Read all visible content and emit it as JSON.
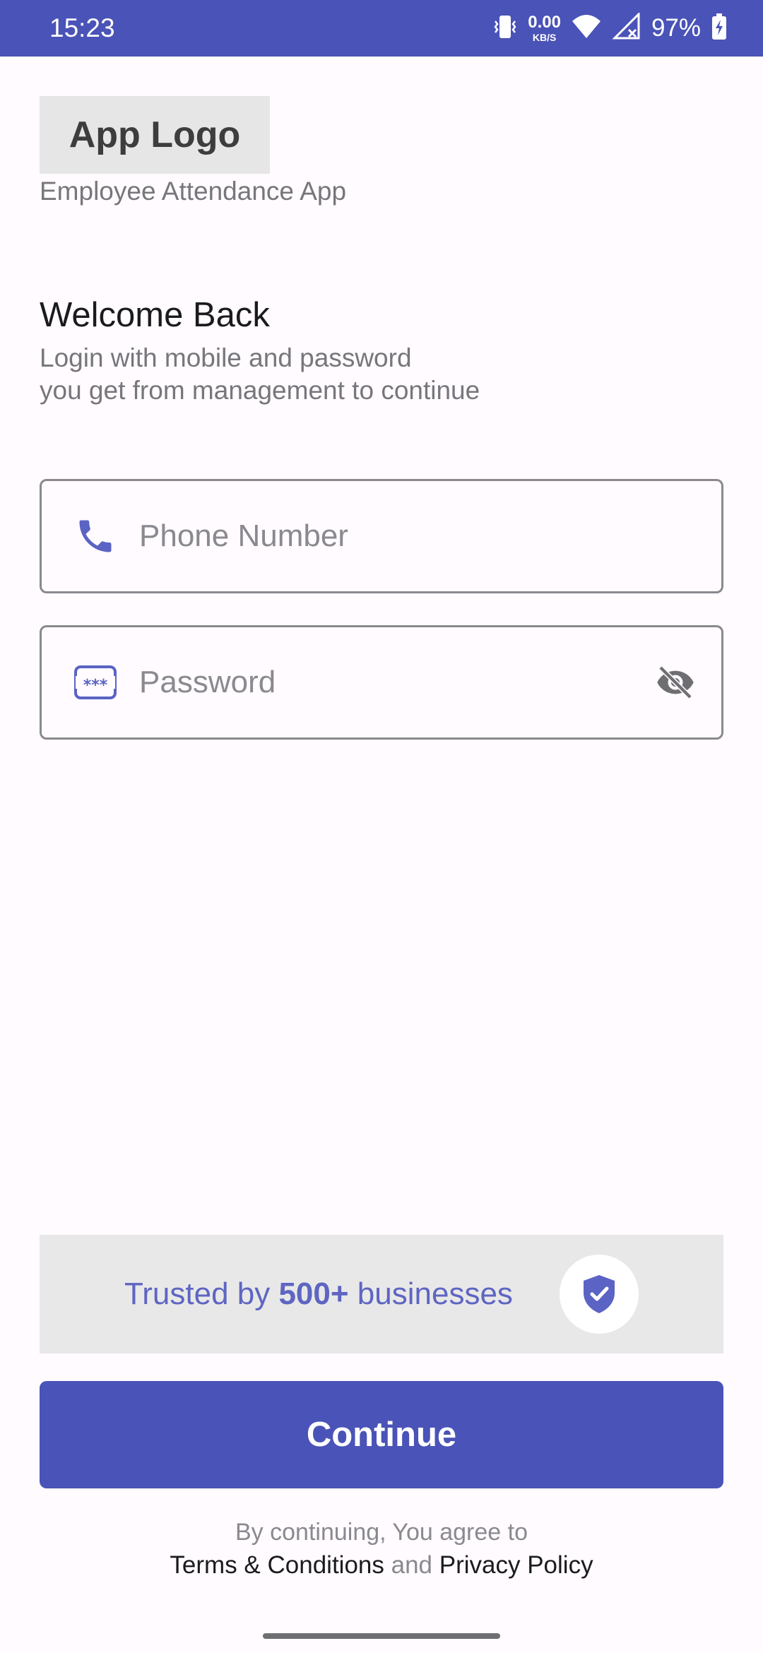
{
  "status_bar": {
    "time": "15:23",
    "net_speed_value": "0.00",
    "net_speed_unit": "KB/S",
    "battery": "97%",
    "icons": [
      "vibrate-icon",
      "wifi-icon",
      "signal-icon",
      "battery-charging-icon"
    ]
  },
  "brand": {
    "logo_text": "App Logo",
    "subtitle": "Employee Attendance App"
  },
  "welcome": {
    "title": "Welcome Back",
    "line1": "Login with mobile and password",
    "line2": "you get from management to continue"
  },
  "form": {
    "phone_placeholder": "Phone Number",
    "phone_value": "",
    "phone_icon": "phone-icon",
    "password_placeholder": "Password",
    "password_value": "",
    "password_icon": "password-dots-icon",
    "toggle_icon": "eye-off-icon"
  },
  "trust": {
    "prefix": "Trusted by ",
    "count": "500+",
    "suffix": " businesses",
    "icon": "shield-check-icon"
  },
  "actions": {
    "continue_label": "Continue"
  },
  "legal": {
    "line1": "By continuing, You agree to",
    "terms": "Terms & Conditions",
    "and": "and",
    "privacy": "Privacy Policy"
  },
  "colors": {
    "primary": "#4a53b7",
    "accent_icon": "#5b63c4",
    "background": "#fffbfe",
    "muted_text": "#77767c"
  }
}
